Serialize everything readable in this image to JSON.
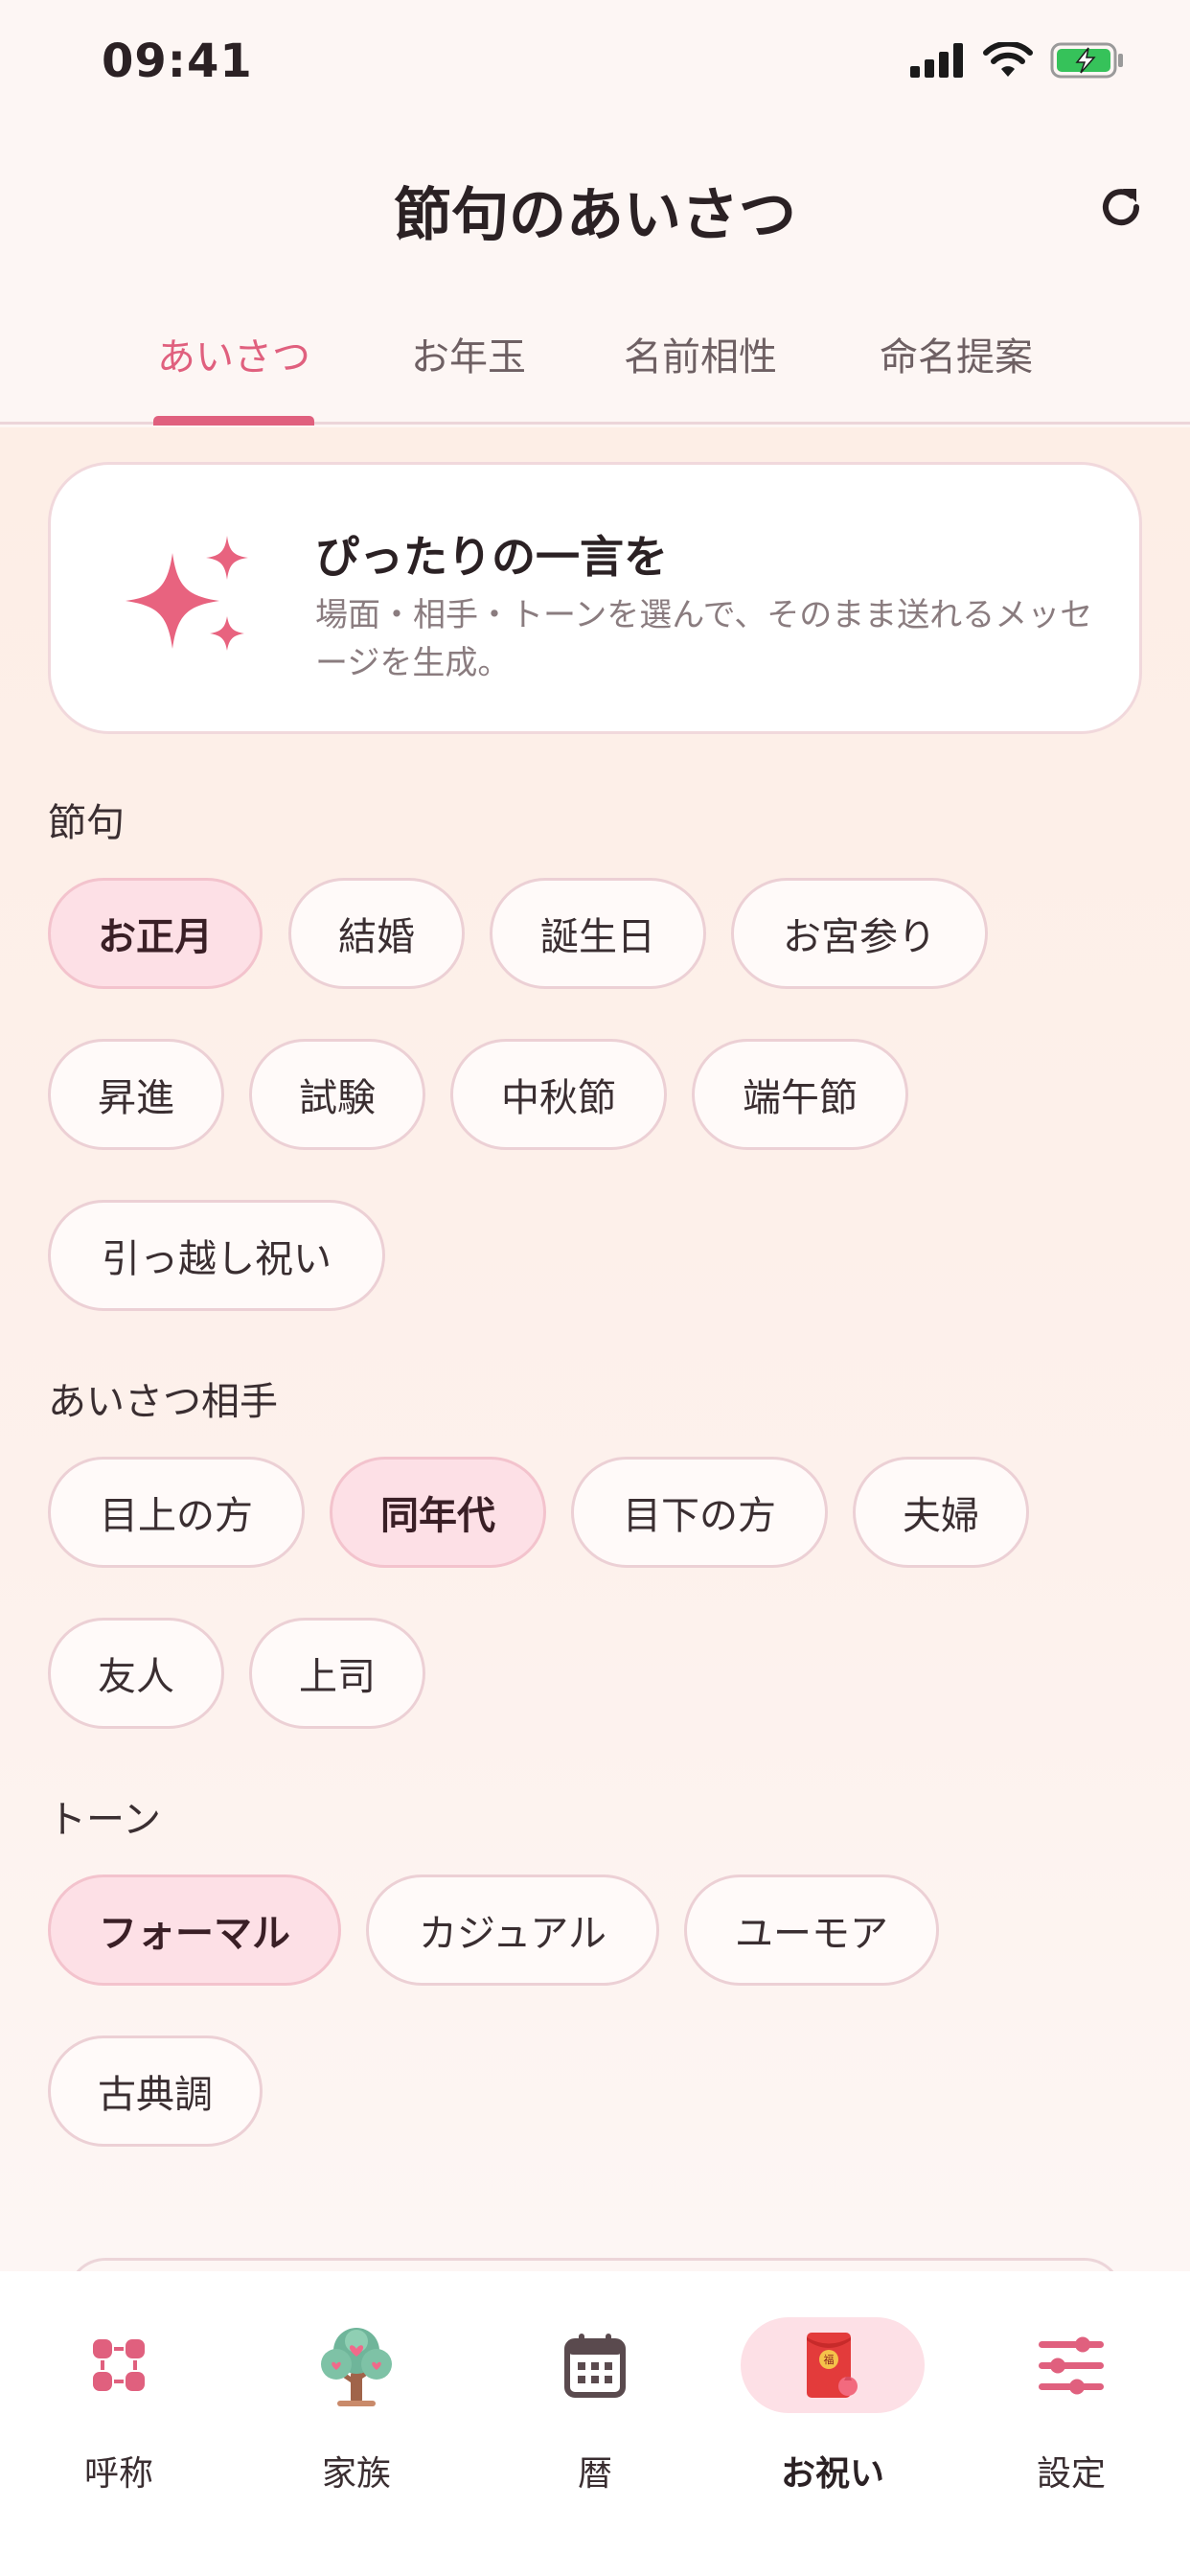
{
  "status_bar": {
    "time": "09:41"
  },
  "header": {
    "title": "節句のあいさつ"
  },
  "tabs": [
    {
      "label": "あいさつ",
      "active": true
    },
    {
      "label": "お年玉",
      "active": false
    },
    {
      "label": "名前相性",
      "active": false
    },
    {
      "label": "命名提案",
      "active": false
    }
  ],
  "hero": {
    "title": "ぴったりの一言を",
    "description": "場面・相手・トーンを選んで、そのまま送れるメッセージを生成。",
    "icon": "sparkles-icon"
  },
  "sections": {
    "occasion": {
      "label": "節句",
      "options": [
        "お正月",
        "結婚",
        "誕生日",
        "お宮参り",
        "昇進",
        "試験",
        "中秋節",
        "端午節",
        "引っ越し祝い"
      ],
      "selected": "お正月"
    },
    "recipient": {
      "label": "あいさつ相手",
      "options": [
        "目上の方",
        "同年代",
        "目下の方",
        "夫婦",
        "友人",
        "上司"
      ],
      "selected": "同年代"
    },
    "tone": {
      "label": "トーン",
      "options": [
        "フォーマル",
        "カジュアル",
        "ユーモア",
        "古典調"
      ],
      "selected": "フォーマル"
    }
  },
  "tabbar": {
    "items": [
      {
        "label": "呼称",
        "icon": "nodes-icon",
        "active": false
      },
      {
        "label": "家族",
        "icon": "family-tree-icon",
        "active": false
      },
      {
        "label": "暦",
        "icon": "calendar-icon",
        "active": false
      },
      {
        "label": "お祝い",
        "icon": "red-envelope-icon",
        "active": true,
        "badge": "福"
      },
      {
        "label": "設定",
        "icon": "sliders-icon",
        "active": false
      }
    ]
  },
  "colors": {
    "accent": "#e0607e",
    "chip_selected_bg": "#fde0e6",
    "background": "#fdf6f4"
  }
}
